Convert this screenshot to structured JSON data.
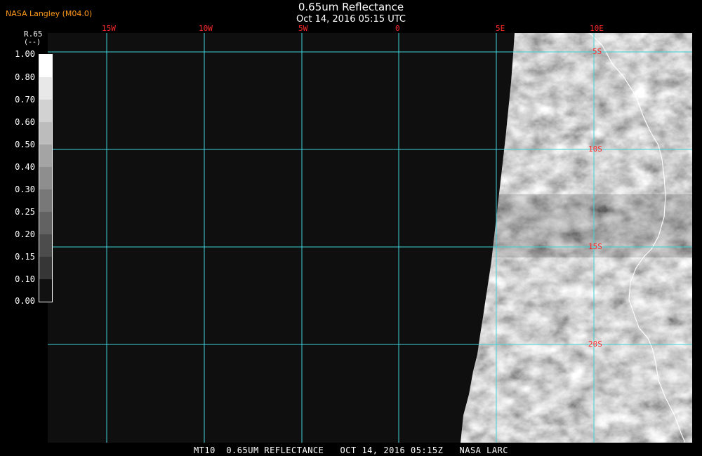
{
  "header": {
    "credit": "NASA Langley (M04.0)",
    "title": "0.65um Reflectance",
    "subtitle": "Oct 14, 2016 05:15 UTC"
  },
  "colorbar": {
    "param": "R.65",
    "unit": "(--)",
    "ticks": [
      "1.00",
      "0.80",
      "0.70",
      "0.60",
      "0.50",
      "0.40",
      "0.30",
      "0.25",
      "0.20",
      "0.15",
      "0.10",
      "0.00"
    ]
  },
  "map": {
    "lon_labels": [
      "15W",
      "10W",
      "5W",
      "0",
      "5E",
      "10E"
    ],
    "lat_labels": [
      "5S",
      "10S",
      "15S",
      "20S"
    ],
    "grid_color": "#3fd3d8",
    "label_color": "#ff2a2a",
    "coast_color": "#ffffff"
  },
  "footer": {
    "text": "MT10  0.65UM REFLECTANCE   OCT 14, 2016 05:15Z   NASA LARC"
  }
}
